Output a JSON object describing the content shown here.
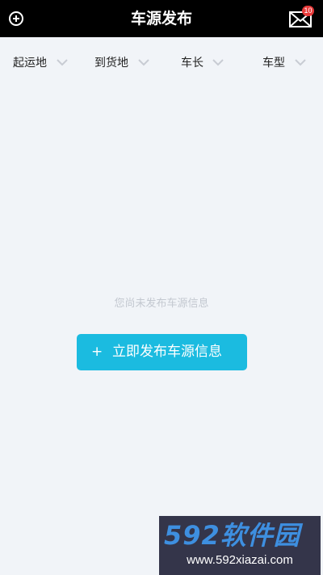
{
  "header": {
    "title": "车源发布",
    "mail_badge": "10",
    "left_icon": "add-circle-icon",
    "right_icon": "mail-icon"
  },
  "filters": [
    {
      "label": "起运地",
      "icon": "chevron-down-icon"
    },
    {
      "label": "到货地",
      "icon": "chevron-down-icon"
    },
    {
      "label": "车长",
      "icon": "chevron-down-icon"
    },
    {
      "label": "车型",
      "icon": "chevron-down-icon"
    }
  ],
  "empty_state": {
    "message": "您尚未发布车源信息",
    "button_plus": "+",
    "button_label": "立即发布车源信息"
  },
  "watermark": {
    "logo": "592软件园",
    "site": "www.592xiazai.com"
  },
  "colors": {
    "header_bg": "#000000",
    "page_bg": "#f1f4f8",
    "accent": "#1bbbe0",
    "badge": "#e83a3a"
  }
}
